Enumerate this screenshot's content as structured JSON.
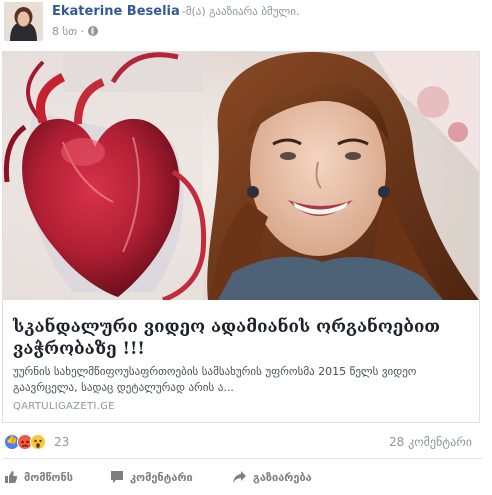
{
  "post": {
    "author_name": "Ekaterine Beselia",
    "action_text": "-მ(ა) გააზიარა ბმული.",
    "timestamp": "8 სთ ·",
    "privacy_icon": "globe-icon"
  },
  "link": {
    "title": "სკანდალური ვიდეო ადამიანის ორგანოებით ვაჭრობაზე !!!",
    "description": "უურნის სახელმწიფოუსაფრთოების სამსახურის უფროსმა 2015 წელს ვიდეო გაავრცელა, სადაც დეტალურად არის ა...",
    "domain": "QARTULIGAZETI.GE"
  },
  "reactions": {
    "icons": [
      "like-icon",
      "angry-icon",
      "wow-icon"
    ],
    "count": "23",
    "comments": "28 კომენტარი"
  },
  "actions": {
    "like": "მომწონს",
    "comment": "კომენტარი",
    "share": "გაზიარება"
  },
  "colors": {
    "author": "#365899",
    "secondary_text": "#90949c",
    "like_blue": "#4a7ff0"
  }
}
